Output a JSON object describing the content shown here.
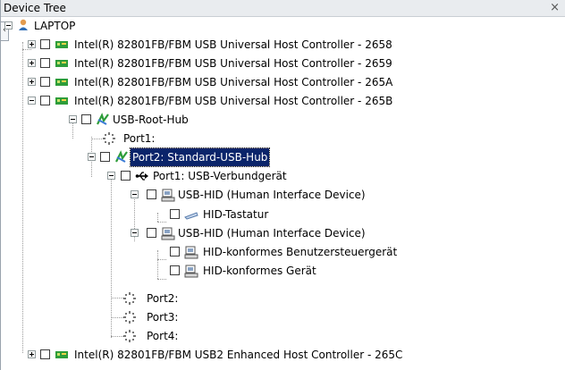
{
  "panel": {
    "title": "Device Tree",
    "close_glyph": "×",
    "edge_glyph": "‹"
  },
  "tree": {
    "root": "LAPTOP",
    "hc_2658": "Intel(R) 82801FB/FBM USB Universal Host Controller - 2658",
    "hc_2659": "Intel(R) 82801FB/FBM USB Universal Host Controller - 2659",
    "hc_265a": "Intel(R) 82801FB/FBM USB Universal Host Controller - 265A",
    "hc_265b": "Intel(R) 82801FB/FBM USB Universal Host Controller - 265B",
    "root_hub": "USB-Root-Hub",
    "port1": "Port1:",
    "port2_hub": "Port2: Standard-USB-Hub",
    "verbund": "Port1: USB-Verbundgerät",
    "hid1": "USB-HID (Human Interface Device)",
    "tastatur": "HID-Tastatur",
    "hid2": "USB-HID (Human Interface Device)",
    "benutzer": "HID-konformes Benutzersteuergerät",
    "geraet": "HID-konformes Gerät",
    "port2": "Port2:",
    "port3": "Port3:",
    "port4": "Port4:",
    "hc_265c": "Intel(R) 82801FB/FBM USB2 Enhanced Host Controller - 265C"
  },
  "colors": {
    "selection": "#0a246a",
    "titlebar": "#e9ecef",
    "connector": "#9b9b9b"
  },
  "icons": [
    "laptop-icon",
    "usb-controller-icon",
    "usb-hub-icon",
    "usb-port-icon",
    "usb-composite-icon",
    "hid-device-icon",
    "keyboard-icon"
  ]
}
